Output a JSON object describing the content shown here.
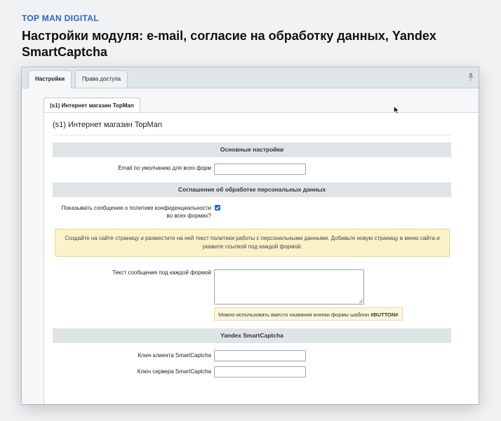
{
  "header": {
    "brand": "TOP MAN DIGITAL",
    "title": "Настройки модуля: e-mail, согласие на обработку данных, Yandex SmartCaptcha"
  },
  "top_tabs": [
    {
      "label": "Настройки",
      "active": true
    },
    {
      "label": "Права доступа",
      "active": false
    }
  ],
  "inner_tab": {
    "label": "(s1) Интернет магазин TopMan"
  },
  "site_heading": "(s1) Интернет магазин TopMan",
  "sections": {
    "main": "Основные настройки",
    "consent": "Соглашение об обработке персональных данных",
    "captcha": "Yandex SmartCaptcha"
  },
  "fields": {
    "email_label": "Email по умолчанию для всех форм",
    "email_value": "",
    "show_policy_label_1": "Показывать сообщение о политике конфиденциальности",
    "show_policy_label_2": "во всех формах?",
    "show_policy_checked": true,
    "message_text_label": "Текст сообщения под каждой формой",
    "message_text_value": "",
    "client_key_label": "Ключ клиента SmartCaptcha",
    "client_key_value": "",
    "server_key_label": "Ключ сервера SmartCaptcha",
    "server_key_value": ""
  },
  "notice": "Создайте на сайте страницу и разместите на ней текст политики работы с персональными данными. Добавьте новую страницу в меню сайта и укажите ссылкой под каждой формой.",
  "hint": {
    "text": "Можно использовать вместо названия кнопки формы шаблон ",
    "code": "#BUTTON#"
  },
  "colors": {
    "brand": "#2d63c8",
    "checkbox": "#1b64d9",
    "section_bg": "#dfe5e7",
    "notice_bg": "#fbf2c8"
  },
  "icons": [
    "pin-icon",
    "checkmark-icon",
    "resize-handle-icon",
    "mouse-cursor-icon"
  ]
}
